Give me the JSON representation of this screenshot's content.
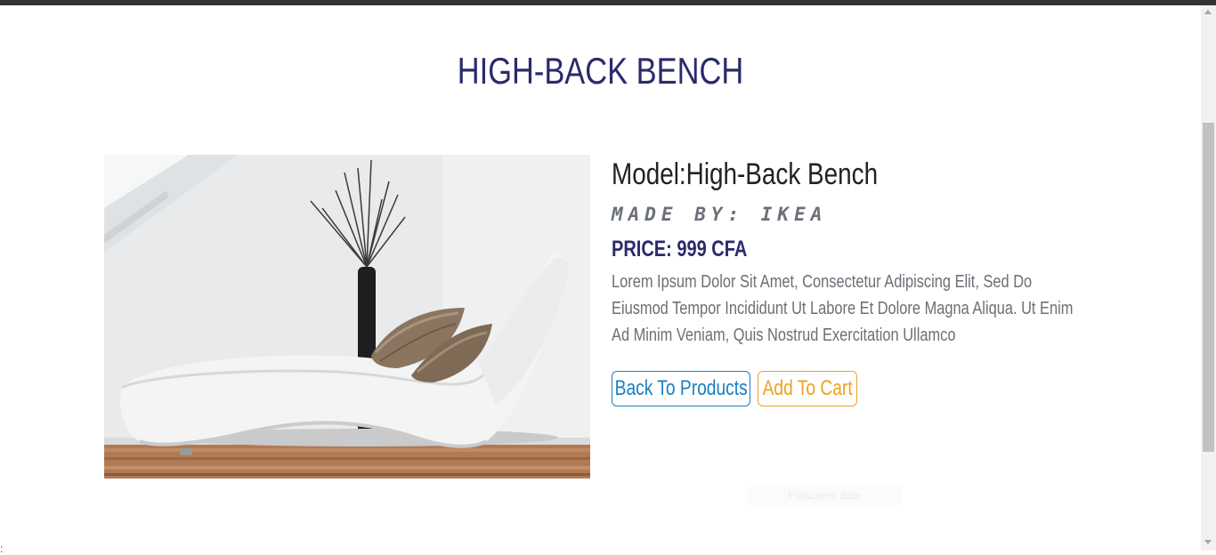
{
  "page_title": "HIGH-BACK BENCH",
  "product": {
    "image_alt": "White chaise lounge with striped cushions and a vase",
    "model": "Model:High-Back Bench",
    "made_by": "Made By: IKEA",
    "price": "PRICE: 999 CFA",
    "description": "Lorem Ipsum Dolor Sit Amet, Consectetur Adipiscing Elit, Sed Do Eiusmod Tempor Incididunt Ut Labore Et Dolore Magna Aliqua. Ut Enim Ad Minim Veniam, Quis Nostrud Exercitation Ullamco"
  },
  "buttons": {
    "back_label": "Back To Products",
    "cart_label": "Add To Cart"
  },
  "overlay": {
    "fullscreen_tip": "Fullscreen Size"
  },
  "corner_mark": ":",
  "colors": {
    "title": "#2a2a6c",
    "price": "#2a2a6c",
    "back_button": "#1a7fc1",
    "cart_button": "#f0a020",
    "top_bar": "#333337"
  }
}
